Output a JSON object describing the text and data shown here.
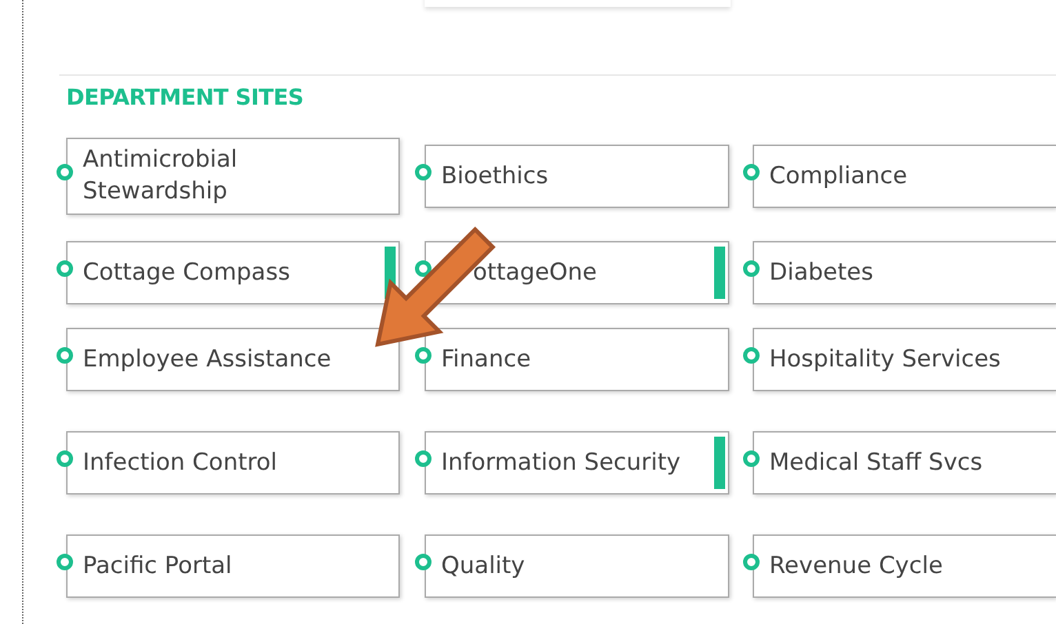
{
  "section_title": "DEPARTMENT SITES",
  "rows": [
    {
      "sites": [
        {
          "label": "Antimicrobial Stewardship",
          "flagged": false
        },
        {
          "label": "Bioethics",
          "flagged": false
        },
        {
          "label": "Compliance",
          "flagged": false
        }
      ]
    },
    {
      "sites": [
        {
          "label": "Cottage Compass",
          "flagged": true
        },
        {
          "label": "ottageOne",
          "flagged": true,
          "covered": true
        },
        {
          "label": "Diabetes",
          "flagged": false
        }
      ]
    },
    {
      "sites": [
        {
          "label": "Employee Assistance",
          "flagged": false
        },
        {
          "label": "Finance",
          "flagged": false
        },
        {
          "label": "Hospitality Services",
          "flagged": false
        }
      ]
    },
    {
      "sites": [
        {
          "label": "Infection Control",
          "flagged": false
        },
        {
          "label": "Information Security",
          "flagged": true
        },
        {
          "label": "Medical Staff Svcs",
          "flagged": false
        }
      ]
    },
    {
      "sites": [
        {
          "label": "Pacific Portal",
          "flagged": false
        },
        {
          "label": "Quality",
          "flagged": false
        },
        {
          "label": "Revenue Cycle",
          "flagged": false
        }
      ]
    }
  ]
}
